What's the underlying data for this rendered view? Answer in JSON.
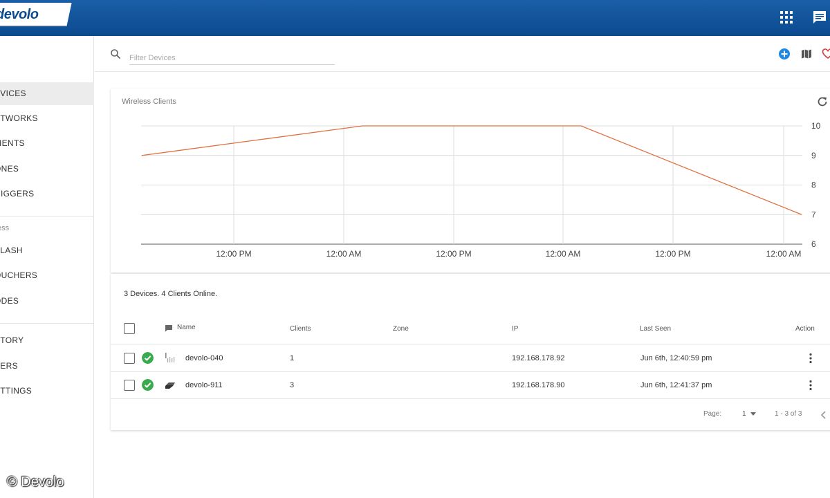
{
  "header": {
    "logo": "devolo",
    "icons": [
      "apps-grid-icon",
      "chat-icon"
    ],
    "colors": {
      "bar": "#0b4a8f",
      "accent": "#1a5fa8"
    }
  },
  "sidebar": {
    "items_top": [
      {
        "label": "EVICES",
        "active": true
      },
      {
        "label": "ETWORKS"
      },
      {
        "label": "LIENTS"
      },
      {
        "label": "ONES"
      },
      {
        "label": "RIGGERS"
      }
    ],
    "section_label": "ess",
    "items_mid": [
      {
        "label": "PLASH"
      },
      {
        "label": "OUCHERS"
      },
      {
        "label": "ODES"
      }
    ],
    "items_bottom": [
      {
        "label": "STORY"
      },
      {
        "label": "SERS"
      },
      {
        "label": "ETTINGS"
      }
    ]
  },
  "toolbar": {
    "search_placeholder": "Filter Devices",
    "icons": [
      "add-circle-icon",
      "map-icon",
      "heart-icon"
    ]
  },
  "chart": {
    "title": "Wireless Clients",
    "line_color": "#e07040"
  },
  "chart_data": {
    "type": "line",
    "title": "Wireless Clients",
    "x": [
      "12:00 PM",
      "12:00 AM",
      "12:00 PM",
      "12:00 AM",
      "12:00 PM",
      "12:00 AM"
    ],
    "y_ticks": [
      10,
      9,
      8,
      7,
      6
    ],
    "ylim": [
      6,
      10
    ],
    "grid": true,
    "series": [
      {
        "values": [
          9,
          10,
          10,
          7
        ],
        "color": "#e07040"
      }
    ]
  },
  "devices": {
    "summary": "3 Devices. 4 Clients Online.",
    "columns": {
      "name": "Name",
      "clients": "Clients",
      "zone": "Zone",
      "ip": "IP",
      "last_seen": "Last Seen",
      "action": "Action"
    },
    "rows": [
      {
        "name": "devolo-040",
        "clients": "1",
        "zone": "",
        "ip": "192.168.178.92",
        "last_seen": "Jun 6th, 12:40:59 pm",
        "icon": "wifi-antenna-icon"
      },
      {
        "name": "devolo-911",
        "clients": "3",
        "zone": "",
        "ip": "192.168.178.90",
        "last_seen": "Jun 6th, 12:41:37 pm",
        "icon": "access-point-icon"
      }
    ],
    "pager": {
      "label": "Page:",
      "page": "1",
      "range": "1 - 3 of 3"
    }
  },
  "watermark": "© Devolo"
}
